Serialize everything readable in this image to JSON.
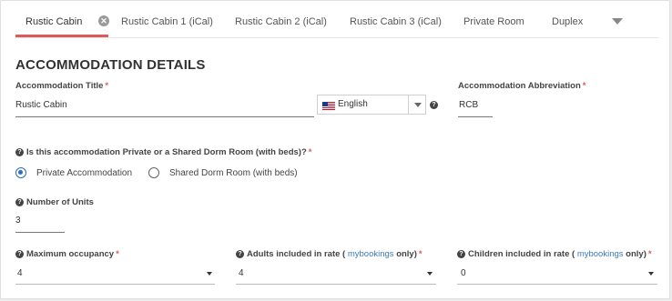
{
  "tabs": [
    {
      "label": "Rustic Cabin",
      "active": true
    },
    {
      "label": "Rustic Cabin 1 (iCal)"
    },
    {
      "label": "Rustic Cabin 2 (iCal)"
    },
    {
      "label": "Rustic Cabin 3 (iCal)"
    },
    {
      "label": "Private Room"
    },
    {
      "label": "Duplex"
    }
  ],
  "tab_close_glyph": "✕",
  "accent_color": "#e05a5a",
  "section_title": "ACCOMMODATION DETAILS",
  "title_field": {
    "label": "Accommodation Title",
    "required": "*",
    "value": "Rustic Cabin"
  },
  "language_select": {
    "value": "English",
    "icon": "us-flag-icon"
  },
  "abbrev_field": {
    "label": "Accommodation Abbreviation",
    "required": "*",
    "value": "RCB"
  },
  "type_question": {
    "label": "Is this accommodation Private or a Shared Dorm Room (with beds)?",
    "required": "*"
  },
  "type_options": [
    {
      "label": "Private Accommodation",
      "selected": true
    },
    {
      "label": "Shared Dorm Room (with beds)",
      "selected": false
    }
  ],
  "units_field": {
    "label": "Number of Units",
    "value": "3"
  },
  "max_occupancy": {
    "label": "Maximum occupancy",
    "required": "*",
    "value": "4"
  },
  "adults_rate": {
    "label_pre": "Adults included in rate (",
    "link": "mybookings",
    "label_post": "only)",
    "required": "*",
    "value": "4"
  },
  "children_rate": {
    "label_pre": "Children included in rate (",
    "link": "mybookings",
    "label_post": "only)",
    "required": "*",
    "value": "0"
  },
  "help_glyph": "?"
}
